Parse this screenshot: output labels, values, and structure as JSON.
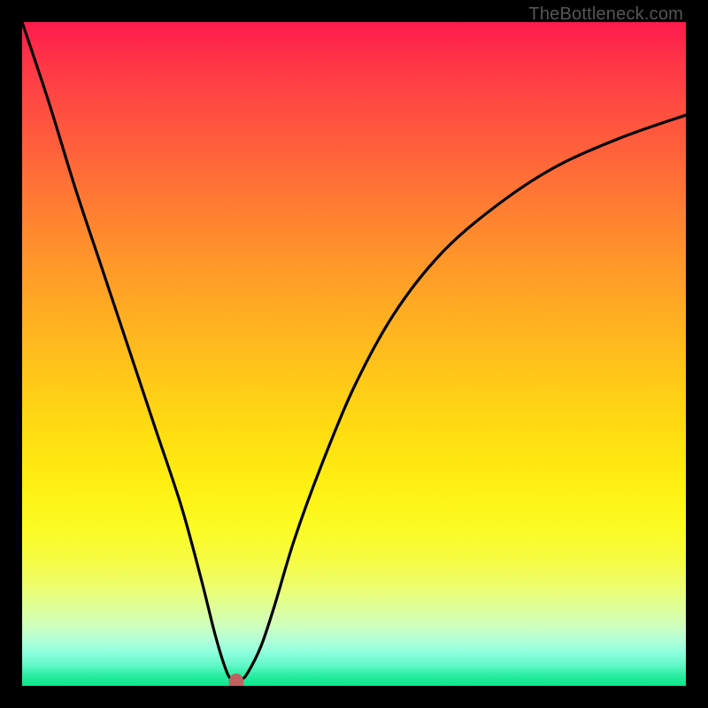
{
  "watermark": "TheBottleneck.com",
  "chart_data": {
    "type": "line",
    "title": "",
    "xlabel": "",
    "ylabel": "",
    "xlim": [
      0,
      100
    ],
    "ylim": [
      0,
      100
    ],
    "grid": false,
    "legend": null,
    "background_gradient": {
      "top": "#ff1a4d",
      "mid": "#ffd81a",
      "bottom": "#0be48a"
    },
    "series": [
      {
        "name": "bottleneck-curve",
        "color": "#000000",
        "x": [
          0,
          4,
          8,
          12,
          16,
          20,
          24,
          27,
          29,
          30.5,
          31.5,
          33,
          34,
          36,
          38,
          41,
          45,
          50,
          56,
          63,
          71,
          80,
          90,
          100
        ],
        "y": [
          100,
          88,
          75,
          63,
          51,
          39,
          27,
          16,
          8,
          3,
          1,
          1,
          2,
          6,
          12,
          22,
          33,
          45,
          56,
          65,
          72,
          78,
          82.5,
          86
        ]
      }
    ],
    "marker": {
      "name": "optimal-point",
      "x": 32.3,
      "y": 0.6,
      "color": "#c16160"
    }
  }
}
